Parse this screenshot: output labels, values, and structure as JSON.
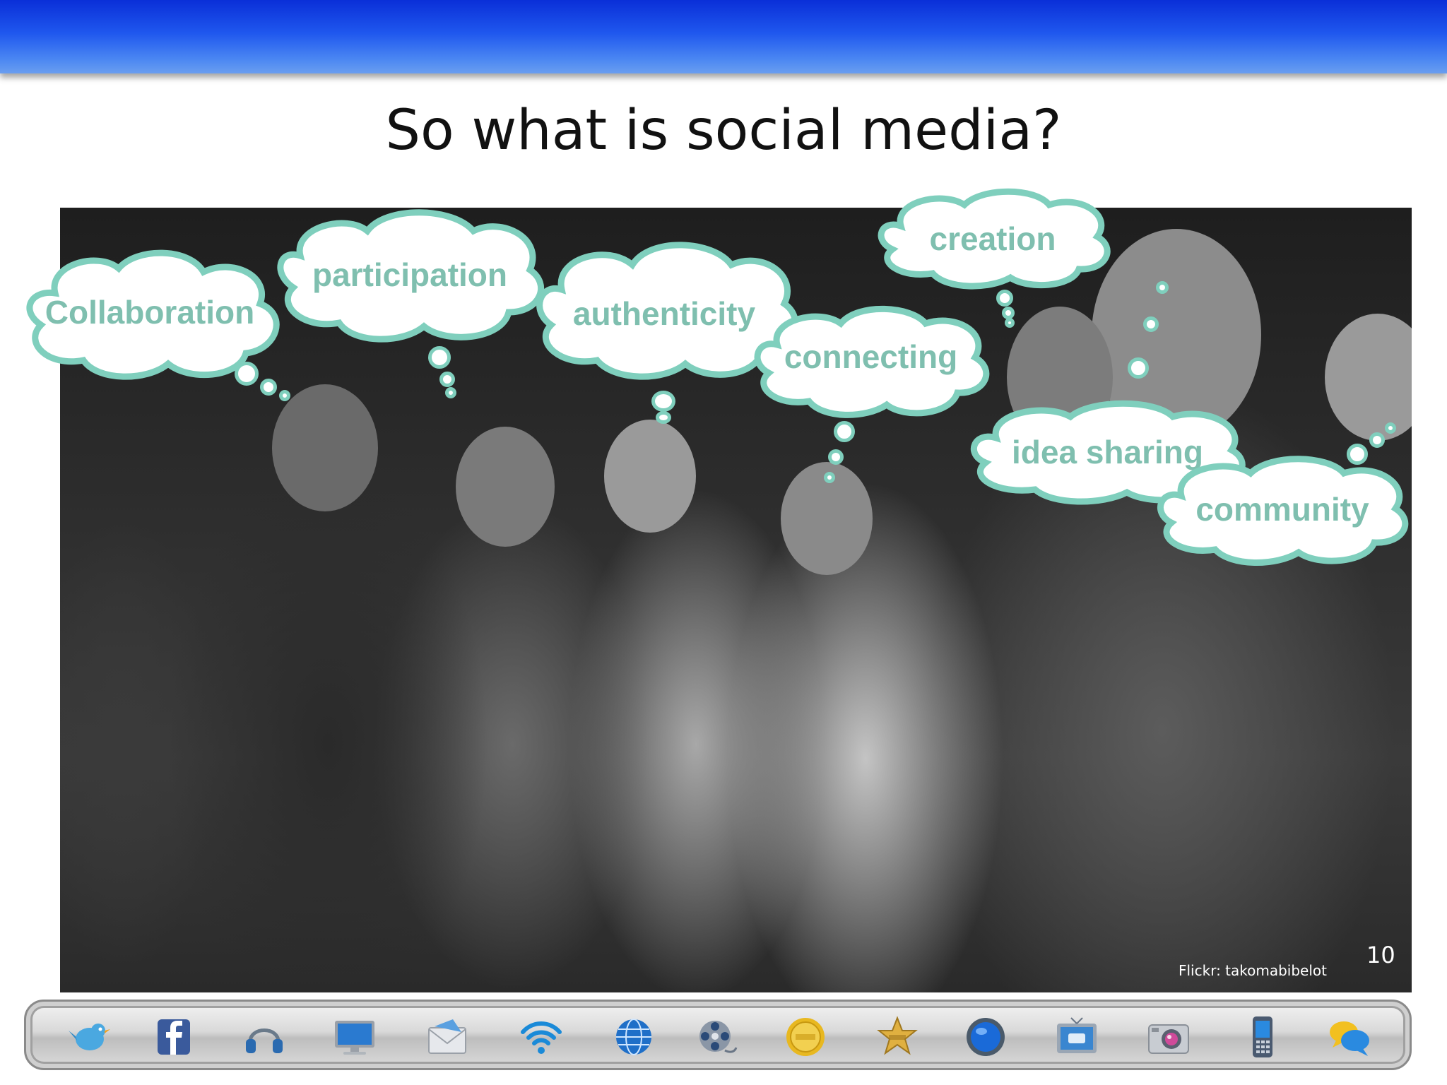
{
  "slide": {
    "title": "So what is social media?",
    "page_number": "10"
  },
  "photo": {
    "credit": "Flickr: takomabibelot"
  },
  "thought_bubbles": [
    {
      "id": "collaboration",
      "label": "Collaboration"
    },
    {
      "id": "participation",
      "label": "participation"
    },
    {
      "id": "authenticity",
      "label": "authenticity"
    },
    {
      "id": "connecting",
      "label": "connecting"
    },
    {
      "id": "creation",
      "label": "creation"
    },
    {
      "id": "idea-sharing",
      "label": "idea sharing"
    },
    {
      "id": "community",
      "label": "community"
    }
  ],
  "colors": {
    "header_blue": "#1f57ee",
    "bubble_outline": "#7fcfbd",
    "bubble_text": "#7fbfaf"
  },
  "dock": {
    "icons": [
      "twitter-bird-icon",
      "facebook-icon",
      "headphones-icon",
      "monitor-icon",
      "envelope-icon",
      "wifi-icon",
      "globe-icon",
      "film-reel-icon",
      "button-badge-icon",
      "sheriff-star-badge-icon",
      "blue-orb-icon",
      "youtube-tv-icon",
      "camera-icon",
      "mobile-phone-icon",
      "chat-bubbles-icon"
    ]
  }
}
